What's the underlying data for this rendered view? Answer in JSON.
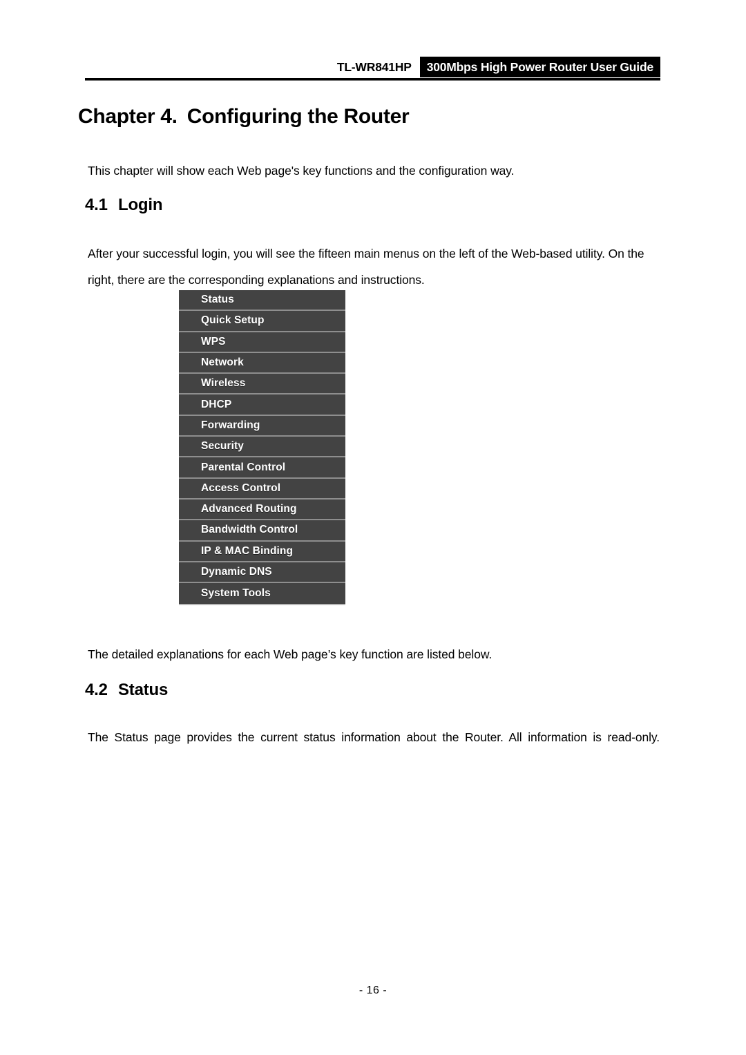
{
  "header": {
    "model": "TL-WR841HP",
    "title": "300Mbps High Power Router User Guide"
  },
  "chapter": {
    "number": "Chapter 4.",
    "title": "Configuring the Router"
  },
  "sections": {
    "intro_paragraph": "This chapter will show each Web page's key functions and the configuration way.",
    "login": {
      "number": "4.1",
      "title": "Login",
      "paragraph": "After your successful login, you will see the fifteen main menus on the left of the Web-based utility. On the right, there are the corresponding explanations and instructions.",
      "caption_paragraph": "The detailed explanations for each Web page’s key function are listed below."
    },
    "status": {
      "number": "4.2",
      "title": "Status",
      "paragraph": "The Status page provides the current status information about the Router. All information is read-only."
    }
  },
  "menu_figure": {
    "items": [
      {
        "label": "Status"
      },
      {
        "label": "Quick Setup"
      },
      {
        "label": "WPS"
      },
      {
        "label": "Network"
      },
      {
        "label": "Wireless"
      },
      {
        "label": "DHCP"
      },
      {
        "label": "Forwarding"
      },
      {
        "label": "Security"
      },
      {
        "label": "Parental Control"
      },
      {
        "label": "Access Control"
      },
      {
        "label": "Advanced Routing"
      },
      {
        "label": "Bandwidth Control"
      },
      {
        "label": "IP & MAC Binding"
      },
      {
        "label": "Dynamic DNS"
      },
      {
        "label": "System Tools"
      }
    ],
    "colors": {
      "item_background": "#434343",
      "item_separator": "#8e8e8e",
      "item_text": "#ffffff"
    }
  },
  "footer": {
    "page_number": "- 16 -"
  }
}
